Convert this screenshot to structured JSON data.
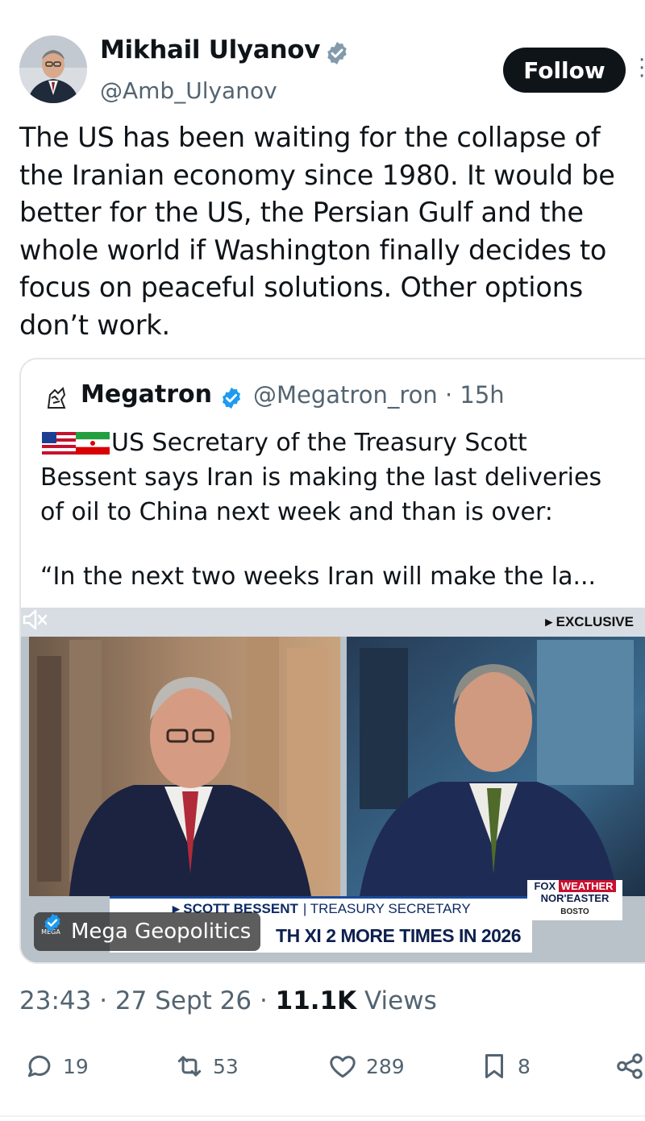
{
  "author": {
    "name": "Mikhail Ulyanov",
    "handle": "@Amb_Ulyanov",
    "verified": true
  },
  "follow_label": "Follow",
  "tweet_text": "The US has been waiting for the collapse of\nthe Iranian economy since 1980. It would be\nbetter for the US, the Persian Gulf and the\nwhole world if Washington finally decides to\nfocus on peaceful solutions. Other options\ndon’t work.",
  "quote": {
    "name": "Megatron",
    "handle_time": "@Megatron_ron · 15h",
    "flags": [
      "us-flag-icon",
      "iran-flag-icon"
    ],
    "text": "US Secretary of the Treasury Scott\nBessent says Iran is making the last deliveries\nof oil to China next week and than is over:",
    "text2": "“In the next two weeks Iran will make the la...",
    "video": {
      "exclusive": "▸ EXCLUSIVE",
      "lower_third_name": "▸ SCOTT BESSENT",
      "lower_third_role": "| TREASURY SECRETARY",
      "ticker": "TH XI 2 MORE TIMES IN 2026",
      "fox_brand": "FOX",
      "fox_weather": "WEATHER",
      "weather_label": "NOR'EASTER",
      "map_label": "BOSTO",
      "watermark_logo": "MEGA",
      "watermark_text": "Mega Geopolitics"
    }
  },
  "meta": {
    "time": "23:43",
    "date": "27 Sept 26",
    "views_count": "11.1K",
    "views_label": "Views"
  },
  "actions": {
    "replies": "19",
    "reposts": "53",
    "likes": "289",
    "bookmarks": "8"
  },
  "colors": {
    "text": "#0f1419",
    "secondary": "#536471",
    "verified": "#1d9bf0",
    "follow_bg": "#0f1419"
  }
}
